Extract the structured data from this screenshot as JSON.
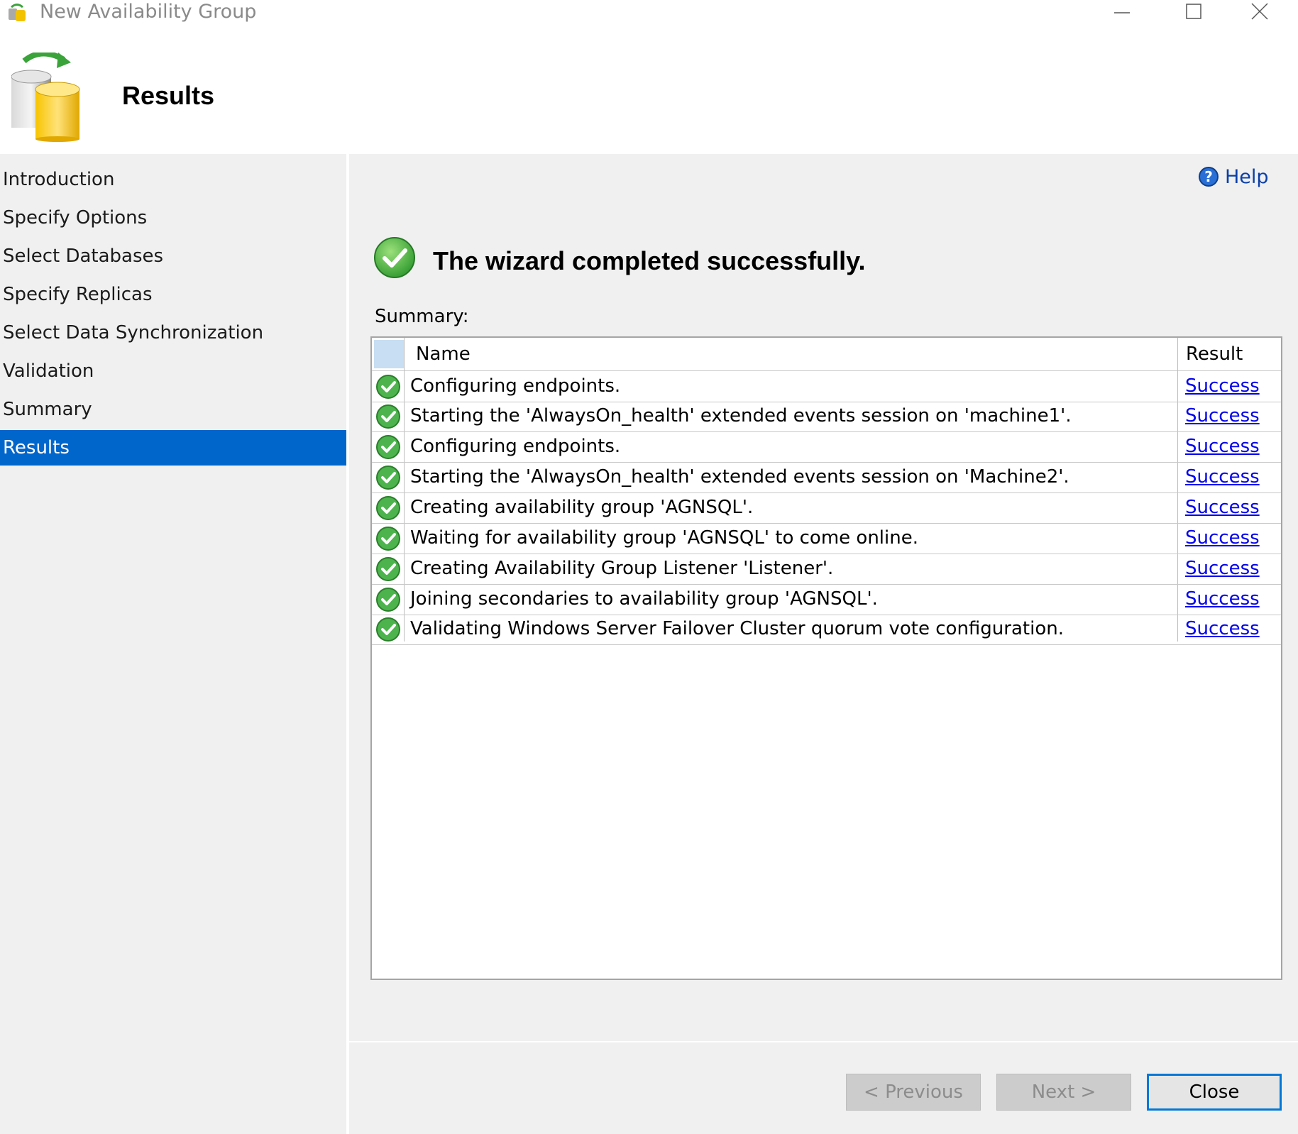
{
  "window": {
    "title": "New Availability Group",
    "controls": [
      "minimize-icon",
      "maximize-icon",
      "close-icon"
    ]
  },
  "header": {
    "icon": "database-sync-icon",
    "title": "Results"
  },
  "nav": {
    "items": [
      {
        "label": "Introduction",
        "active": false
      },
      {
        "label": "Specify Options",
        "active": false
      },
      {
        "label": "Select Databases",
        "active": false
      },
      {
        "label": "Specify Replicas",
        "active": false
      },
      {
        "label": "Select Data Synchronization",
        "active": false
      },
      {
        "label": "Validation",
        "active": false
      },
      {
        "label": "Summary",
        "active": false
      },
      {
        "label": "Results",
        "active": true
      }
    ]
  },
  "main": {
    "help_label": "Help",
    "success_message": "The wizard completed successfully.",
    "summary_label": "Summary:",
    "table": {
      "columns": [
        "Name",
        "Result"
      ],
      "rows": [
        {
          "name": "Configuring endpoints.",
          "result": "Success"
        },
        {
          "name": "Starting the 'AlwaysOn_health' extended events session on 'machine1'.",
          "result": "Success"
        },
        {
          "name": "Configuring endpoints.",
          "result": "Success"
        },
        {
          "name": "Starting the 'AlwaysOn_health' extended events session on 'Machine2'.",
          "result": "Success"
        },
        {
          "name": "Creating availability group 'AGNSQL'.",
          "result": "Success"
        },
        {
          "name": "Waiting for availability group 'AGNSQL' to come online.",
          "result": "Success"
        },
        {
          "name": "Creating Availability Group Listener 'Listener'.",
          "result": "Success"
        },
        {
          "name": "Joining secondaries to availability group 'AGNSQL'.",
          "result": "Success"
        },
        {
          "name": "Validating Windows Server Failover Cluster quorum vote configuration.",
          "result": "Success"
        }
      ]
    }
  },
  "footer": {
    "previous_label": "< Previous",
    "next_label": "Next >",
    "close_label": "Close"
  },
  "colors": {
    "accent": "#0066cc",
    "link": "#0000ee",
    "success_green": "#3fae3f",
    "panel_bg": "#f0f0f0"
  }
}
